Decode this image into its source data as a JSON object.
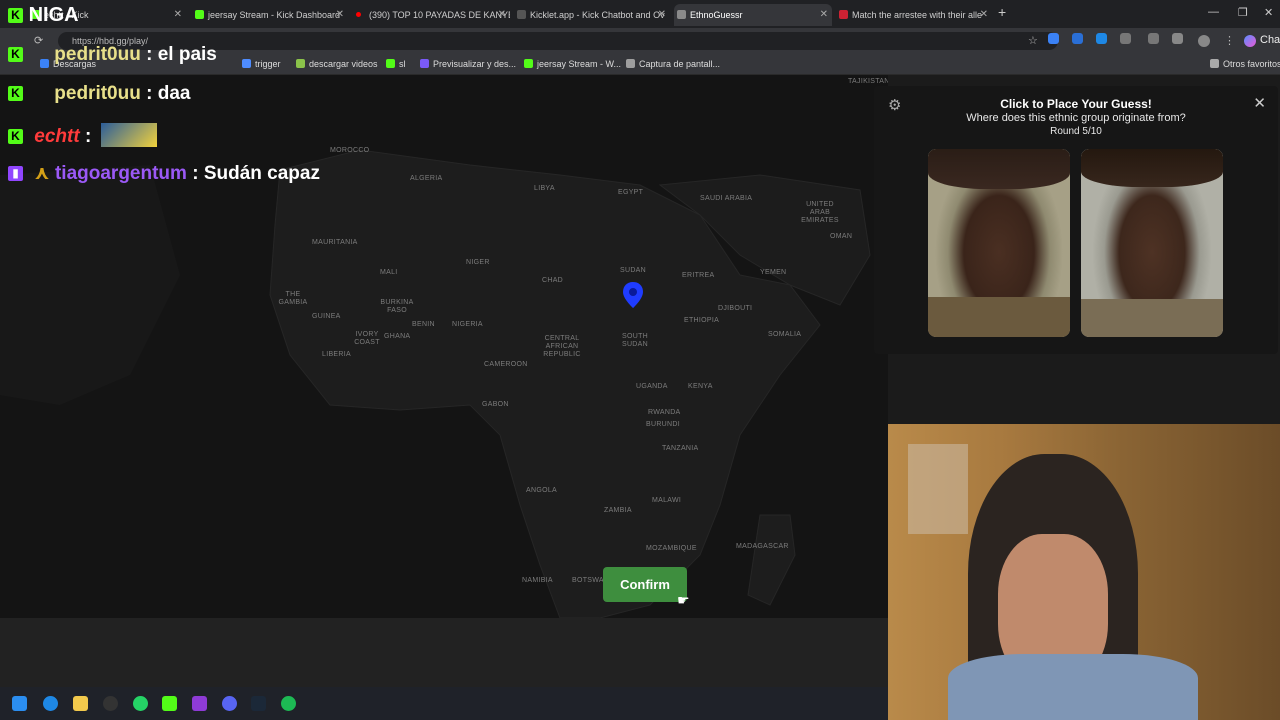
{
  "browser": {
    "tabs": [
      {
        "label": "echtt - Kick",
        "color": "#53fc18",
        "active": false
      },
      {
        "label": "jeersay Stream - Kick Dashboard",
        "color": "#53fc18",
        "active": false
      },
      {
        "label": "(390) TOP 10 PAYADAS DE KANYE",
        "color": "#ff0000",
        "active": false
      },
      {
        "label": "Kicklet.app - Kick Chatbot and Ov",
        "color": "#2d2d2d",
        "active": false
      },
      {
        "label": "EthnoGuessr",
        "color": "#4a4a4a",
        "active": true
      },
      {
        "label": "Match the arrestee with their alle",
        "color": "#c23",
        "active": false
      }
    ],
    "url": "https://hbd.gg/play/",
    "bookmarks": [
      {
        "label": "Descargas",
        "color": "#3b82f6"
      },
      {
        "label": "trigger",
        "color": "#4e8cff"
      },
      {
        "label": "descargar videos",
        "color": "#8bc34a"
      },
      {
        "label": "sl",
        "color": "#53fc18"
      },
      {
        "label": "Previsualizar y des...",
        "color": "#7a5af8"
      },
      {
        "label": "jeersay Stream - W...",
        "color": "#53fc18"
      },
      {
        "label": "Captura de pantall...",
        "color": "#9e9e9e"
      }
    ],
    "other_bookmarks": "Otros favoritos",
    "chat_button": "Chat"
  },
  "map": {
    "countries": [
      {
        "name": "MOROCCO"
      },
      {
        "name": "ALGERIA"
      },
      {
        "name": "LIBYA"
      },
      {
        "name": "EGYPT"
      },
      {
        "name": "SAUDI ARABIA"
      },
      {
        "name": "UNITED ARAB EMIRATES"
      },
      {
        "name": "OMAN"
      },
      {
        "name": "MAURITANIA"
      },
      {
        "name": "MALI"
      },
      {
        "name": "NIGER"
      },
      {
        "name": "CHAD"
      },
      {
        "name": "SUDAN"
      },
      {
        "name": "ERITREA"
      },
      {
        "name": "YEMEN"
      },
      {
        "name": "THE GAMBIA"
      },
      {
        "name": "GUINEA"
      },
      {
        "name": "BURKINA FASO"
      },
      {
        "name": "BENIN"
      },
      {
        "name": "NIGERIA"
      },
      {
        "name": "DJIBOUTI"
      },
      {
        "name": "ETHIOPIA"
      },
      {
        "name": "IVORY COAST"
      },
      {
        "name": "GHANA"
      },
      {
        "name": "CENTRAL AFRICAN REPUBLIC"
      },
      {
        "name": "SOUTH SUDAN"
      },
      {
        "name": "SOMALIA"
      },
      {
        "name": "LIBERIA"
      },
      {
        "name": "CAMEROON"
      },
      {
        "name": "UGANDA"
      },
      {
        "name": "KENYA"
      },
      {
        "name": "GABON"
      },
      {
        "name": "RWANDA"
      },
      {
        "name": "BURUNDI"
      },
      {
        "name": "TANZANIA"
      },
      {
        "name": "ANGOLA"
      },
      {
        "name": "MALAWI"
      },
      {
        "name": "ZAMBIA"
      },
      {
        "name": "MOZAMBIQUE"
      },
      {
        "name": "MADAGASCAR"
      },
      {
        "name": "NAMIBIA"
      },
      {
        "name": "BOTSWANA"
      },
      {
        "name": "TAJIKISTAN"
      },
      {
        "name": "MALAYSIA"
      }
    ],
    "confirm_label": "Confirm"
  },
  "panel": {
    "title": "Click to Place Your Guess!",
    "question": "Where does this ethnic group originate from?",
    "round": "Round 5/10"
  },
  "chat": [
    {
      "user": "NIGA",
      "message": "",
      "user_color": "#ffffff"
    },
    {
      "user": "pedrit0uu",
      "message": "el pais",
      "user_color": "#e8e08a"
    },
    {
      "user": "pedrit0uu",
      "message": "daa",
      "user_color": "#e8e08a"
    },
    {
      "user": "echtt",
      "message": "",
      "user_color": "#ff3b3b"
    },
    {
      "user": "tiagoargentum",
      "message": "Sudán capaz",
      "user_color": "#9b59f6"
    }
  ],
  "chat_separator": ":",
  "colors": {
    "confirm_green": "#3e8e3e",
    "marker_blue": "#1f3cff",
    "kick_green": "#53fc18",
    "twitch_purple": "#9146ff"
  }
}
